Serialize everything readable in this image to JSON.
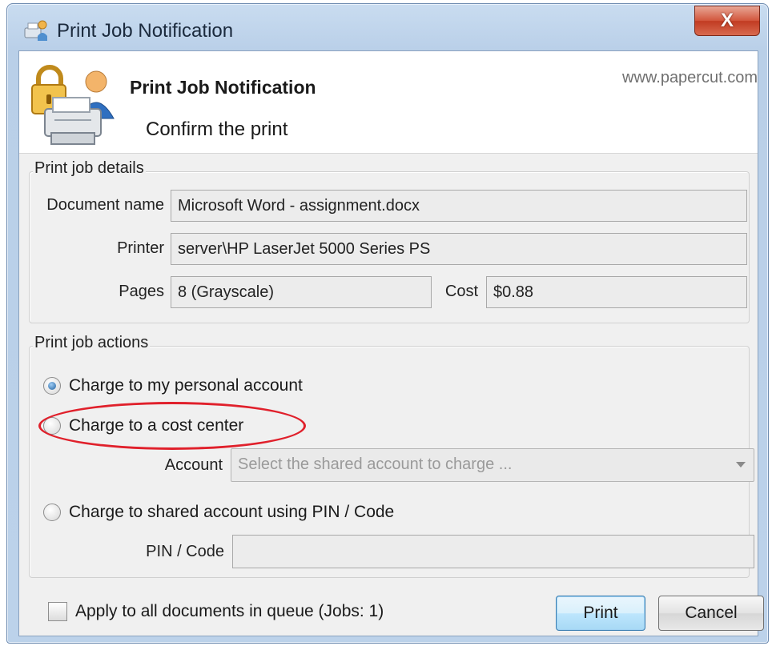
{
  "window": {
    "title": "Print Job Notification",
    "close_label": "X"
  },
  "banner": {
    "title": "Print Job Notification",
    "subtitle": "Confirm the print",
    "url": "www.papercut.com"
  },
  "details": {
    "group_label": "Print job details",
    "document_label": "Document name",
    "document_value": "Microsoft Word - assignment.docx",
    "printer_label": "Printer",
    "printer_value": "server\\HP LaserJet 5000 Series PS",
    "pages_label": "Pages",
    "pages_value": "8   (Grayscale)",
    "cost_label": "Cost",
    "cost_value": "$0.88"
  },
  "actions": {
    "group_label": "Print job actions",
    "option_personal": "Charge to my personal account",
    "option_cost_center": "Charge to a cost center",
    "account_label": "Account",
    "account_placeholder": "Select the shared account to charge ...",
    "option_shared_pin": "Charge to shared account using PIN / Code",
    "pin_label": "PIN / Code",
    "pin_value": "",
    "selected_option": "personal"
  },
  "footer": {
    "apply_all_label": "Apply to all documents in queue (Jobs: 1)",
    "apply_all_checked": false,
    "print_label": "Print",
    "cancel_label": "Cancel"
  },
  "colors": {
    "highlight": "#e0202b",
    "titlebar": "#c9dcf0",
    "close_button": "#c13b22"
  },
  "icons": [
    "printer-lock-user-icon",
    "papercut-app-icon",
    "close-icon",
    "dropdown-arrow-icon"
  ]
}
